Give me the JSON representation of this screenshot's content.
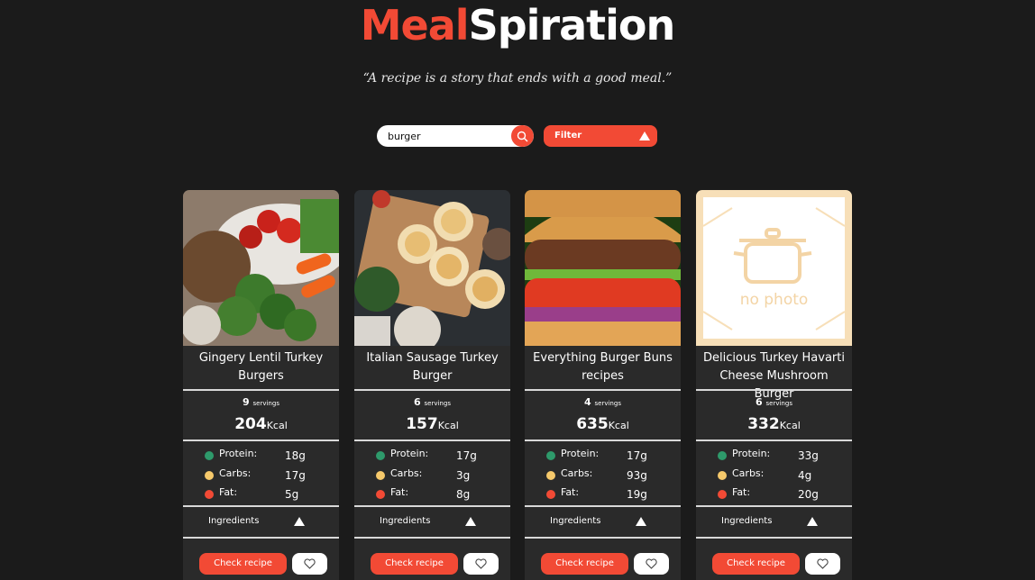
{
  "brand": {
    "part1": "Meal",
    "part2": "Spiration"
  },
  "quote": "“A recipe is a story that ends with a good meal.”",
  "search": {
    "value": "burger",
    "icon": "search-icon"
  },
  "filter": {
    "label": "Filter"
  },
  "colors": {
    "accent": "#f24a35",
    "protein": "#2e9a6b",
    "carbs": "#f6c96b",
    "fat": "#f24a35"
  },
  "cards": [
    {
      "title": "Gingery Lentil Turkey Burgers",
      "servings": "9",
      "servings_unit": "servings",
      "kcal": "204",
      "kcal_unit": "Kcal",
      "protein_label": "Protein:",
      "protein": "18g",
      "carbs_label": "Carbs:",
      "carbs": "17g",
      "fat_label": "Fat:",
      "fat": "5g",
      "ingredients": "Ingredients",
      "check": "Check recipe"
    },
    {
      "title": "Italian Sausage Turkey Burger",
      "servings": "6",
      "servings_unit": "servings",
      "kcal": "157",
      "kcal_unit": "Kcal",
      "protein_label": "Protein:",
      "protein": "17g",
      "carbs_label": "Carbs:",
      "carbs": "3g",
      "fat_label": "Fat:",
      "fat": "8g",
      "ingredients": "Ingredients",
      "check": "Check recipe"
    },
    {
      "title": "Everything Burger Buns recipes",
      "servings": "4",
      "servings_unit": "servings",
      "kcal": "635",
      "kcal_unit": "Kcal",
      "protein_label": "Protein:",
      "protein": "17g",
      "carbs_label": "Carbs:",
      "carbs": "93g",
      "fat_label": "Fat:",
      "fat": "19g",
      "ingredients": "Ingredients",
      "check": "Check recipe"
    },
    {
      "title": "Delicious Turkey Havarti Cheese Mushroom Burger",
      "servings": "6",
      "servings_unit": "servings",
      "kcal": "332",
      "kcal_unit": "Kcal",
      "protein_label": "Protein:",
      "protein": "33g",
      "carbs_label": "Carbs:",
      "carbs": "4g",
      "fat_label": "Fat:",
      "fat": "20g",
      "ingredients": "Ingredients",
      "check": "Check recipe",
      "no_photo": "no photo"
    }
  ]
}
